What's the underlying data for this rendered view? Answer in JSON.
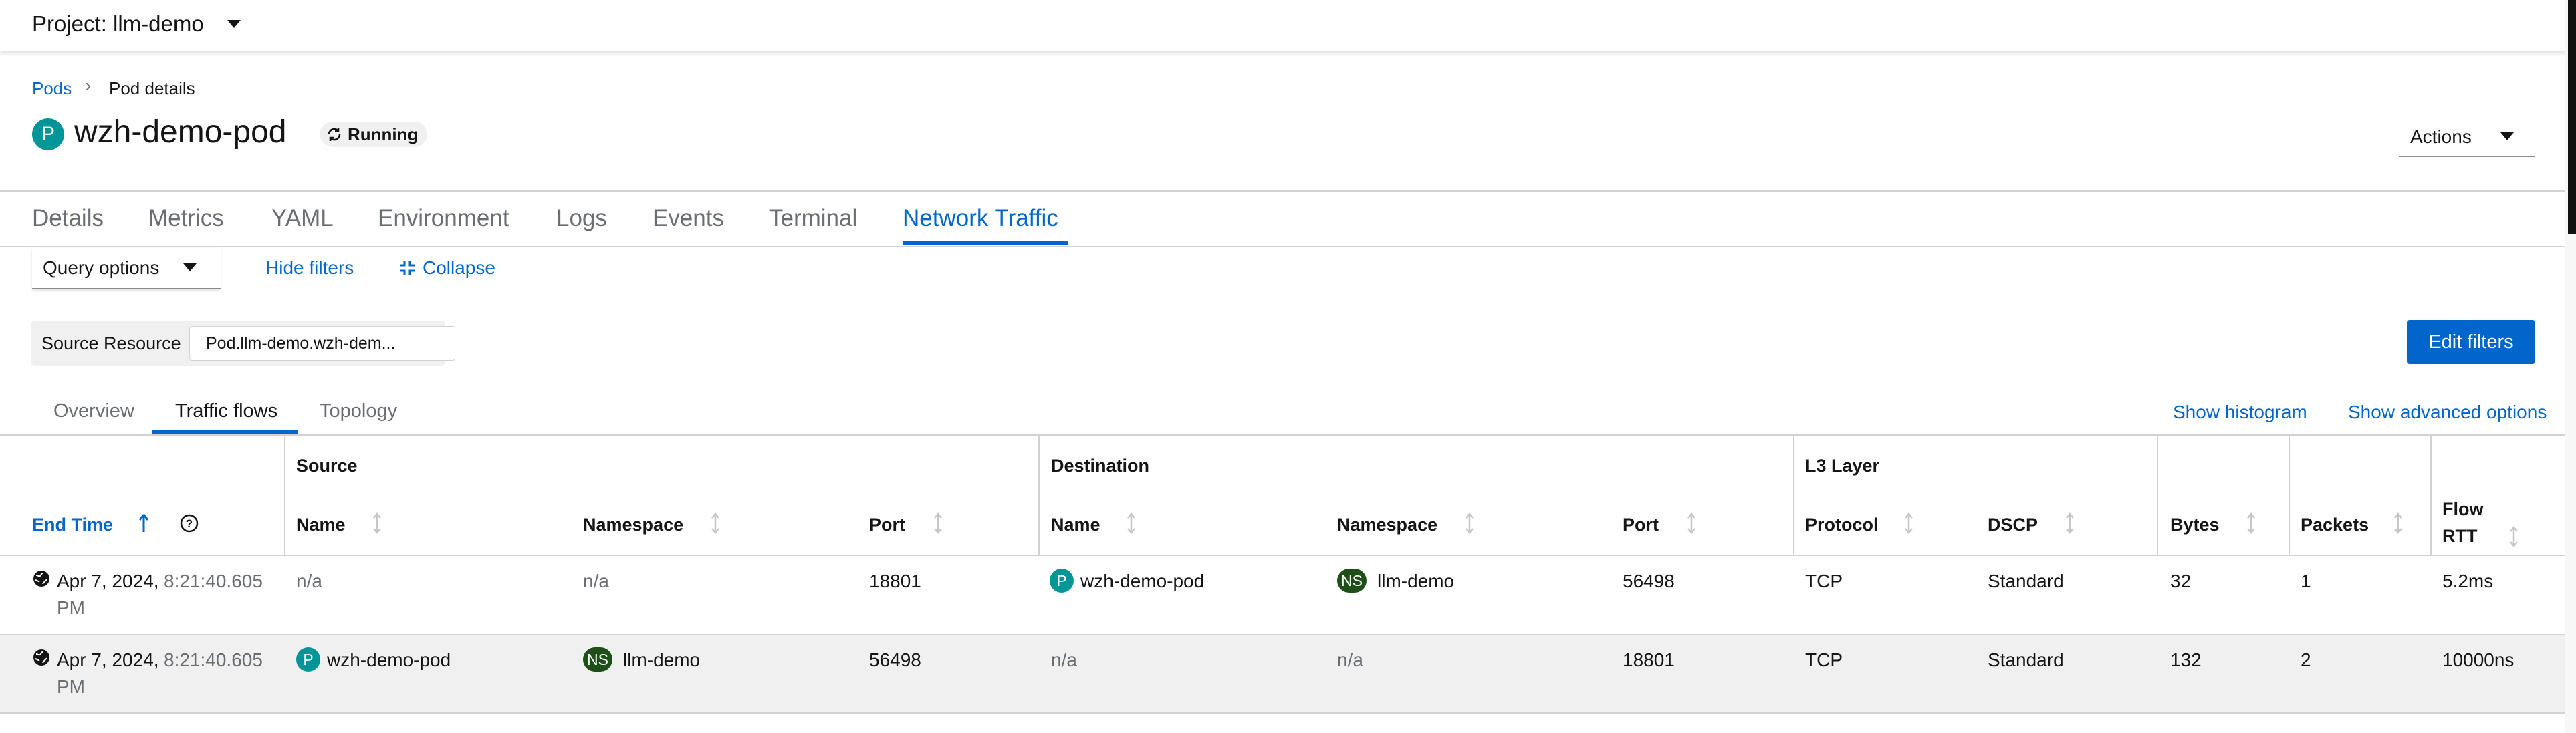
{
  "project": {
    "label": "Project: llm-demo"
  },
  "breadcrumb": {
    "parent": "Pods",
    "current": "Pod details"
  },
  "pod": {
    "badge": "P",
    "name": "wzh-demo-pod",
    "status": "Running"
  },
  "actions_label": "Actions",
  "tabs": [
    {
      "label": "Details"
    },
    {
      "label": "Metrics"
    },
    {
      "label": "YAML"
    },
    {
      "label": "Environment"
    },
    {
      "label": "Logs"
    },
    {
      "label": "Events"
    },
    {
      "label": "Terminal"
    },
    {
      "label": "Network Traffic"
    }
  ],
  "filters": {
    "query_options": "Query options",
    "hide_filters": "Hide filters",
    "collapse": "Collapse",
    "chip_group_label": "Source Resource",
    "chip_value": "Pod.llm-demo.wzh-dem...",
    "edit_filters": "Edit filters"
  },
  "subtabs": [
    {
      "label": "Overview"
    },
    {
      "label": "Traffic flows"
    },
    {
      "label": "Topology"
    }
  ],
  "links": {
    "show_histogram": "Show histogram",
    "show_advanced": "Show advanced options"
  },
  "table": {
    "groups": {
      "source": "Source",
      "destination": "Destination",
      "l3": "L3 Layer"
    },
    "headers": {
      "end_time": "End Time",
      "src_name": "Name",
      "src_namespace": "Namespace",
      "src_port": "Port",
      "dst_name": "Name",
      "dst_namespace": "Namespace",
      "dst_port": "Port",
      "protocol": "Protocol",
      "dscp": "DSCP",
      "bytes": "Bytes",
      "packets": "Packets",
      "flow_rtt_1": "Flow",
      "flow_rtt_2": "RTT"
    },
    "rows": [
      {
        "date": "Apr 7, 2024,",
        "time": "8:21:40.605",
        "ampm": "PM",
        "src_name": "n/a",
        "src_namespace": "n/a",
        "src_port": "18801",
        "dst_badge": "P",
        "dst_name": "wzh-demo-pod",
        "dst_ns_badge": "NS",
        "dst_namespace": "llm-demo",
        "dst_port": "56498",
        "protocol": "TCP",
        "dscp": "Standard",
        "bytes": "32",
        "packets": "1",
        "flow_rtt": "5.2ms"
      },
      {
        "date": "Apr 7, 2024,",
        "time": "8:21:40.605",
        "ampm": "PM",
        "src_badge": "P",
        "src_name": "wzh-demo-pod",
        "src_ns_badge": "NS",
        "src_namespace": "llm-demo",
        "src_port": "56498",
        "dst_name": "n/a",
        "dst_namespace": "n/a",
        "dst_port": "18801",
        "protocol": "TCP",
        "dscp": "Standard",
        "bytes": "132",
        "packets": "2",
        "flow_rtt": "10000ns"
      }
    ]
  }
}
